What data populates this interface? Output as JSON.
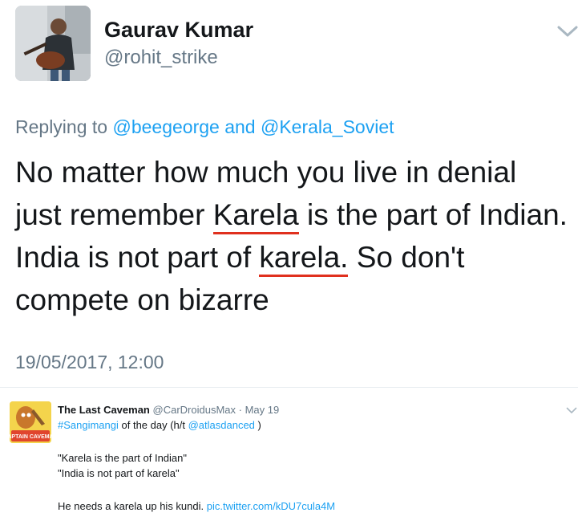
{
  "author": {
    "name": "Gaurav Kumar",
    "handle": "@rohit_strike"
  },
  "reply": {
    "prefix": "Replying to ",
    "mention1": "@beegeorge",
    "conj": " and ",
    "mention2": "@Kerala_Soviet"
  },
  "tweet": {
    "line1": "No matter how much you live in denial",
    "line2_pre": "just remember ",
    "line2_ul": "Karela",
    "line2_post": " is the part of Indian.",
    "line3_pre": "India is not part of ",
    "line3_ul": "karela.",
    "line3_post": " So don't",
    "line4": "compete on bizarre",
    "underline_color": "#e0301e"
  },
  "timestamp": "19/05/2017, 12:00",
  "quoted": {
    "name": "The Last Caveman",
    "handle": "@CarDroidusMax",
    "dot": " · ",
    "date": "May 19",
    "hashtag": "#Sangimangi",
    "line1_mid": " of the day (h/t ",
    "mention": "@atlasdanced",
    "line1_end": " )",
    "quote1": "\"Karela is the part of Indian\"",
    "quote2": "\"India is not part of karela\"",
    "line_last_text": "He needs a karela up his kundi. ",
    "link": "pic.twitter.com/kDU7cula4M",
    "avatar_caption": "CAPTAIN CAVEMAN"
  },
  "colors": {
    "link": "#1da1f2",
    "secondary_text": "#657786"
  },
  "icons": {
    "menu": "chevron-down-icon"
  }
}
